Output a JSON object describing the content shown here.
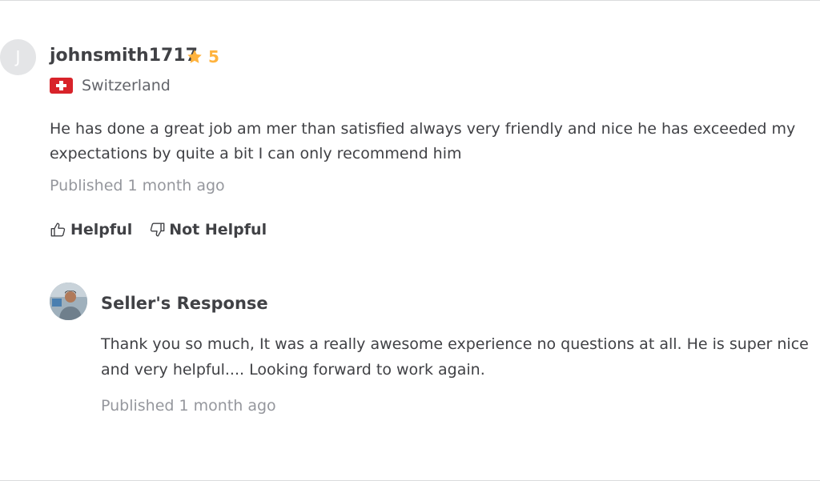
{
  "review": {
    "avatar_initial": "J",
    "username": "johnsmith1717",
    "rating": "5",
    "star_color": "#ffb33e",
    "country": "Switzerland",
    "flag_icon": "switzerland-flag-icon",
    "text": "He has done a great job am mer than satisfied always very friendly and nice he has exceeded my expectations by quite a bit I can only recommend him",
    "published": "Published 1 month ago"
  },
  "actions": {
    "helpful_label": "Helpful",
    "helpful_icon": "thumbs-up-icon",
    "not_helpful_label": "Not Helpful",
    "not_helpful_icon": "thumbs-down-icon"
  },
  "seller_response": {
    "title": "Seller's Response",
    "text": "Thank you so much, It was a really awesome experience no questions at all. He is super nice and very helpful.... Looking forward to work again.",
    "published": "Published 1 month ago"
  }
}
